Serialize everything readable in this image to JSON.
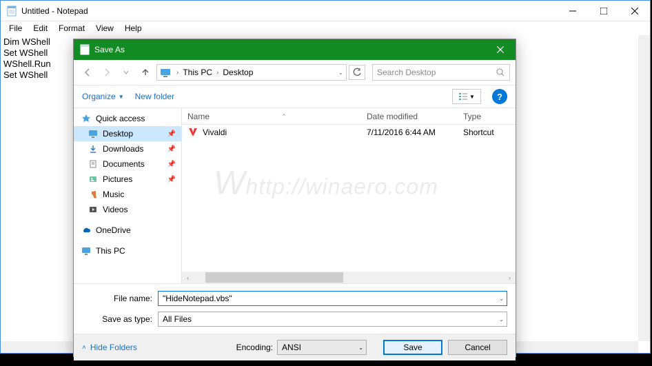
{
  "notepad": {
    "title": "Untitled - Notepad",
    "menu": {
      "file": "File",
      "edit": "Edit",
      "format": "Format",
      "view": "View",
      "help": "Help"
    },
    "content_line1": "Dim WShell",
    "content_line2": "Set WShell",
    "content_line3": "WShell.Run",
    "content_line4": "Set WShell"
  },
  "dialog": {
    "title": "Save As",
    "breadcrumb": {
      "part1": "This PC",
      "part2": "Desktop"
    },
    "search_placeholder": "Search Desktop",
    "toolbar": {
      "organize": "Organize",
      "newfolder": "New folder"
    },
    "nav": {
      "quick_access": "Quick access",
      "desktop": "Desktop",
      "downloads": "Downloads",
      "documents": "Documents",
      "pictures": "Pictures",
      "music": "Music",
      "videos": "Videos",
      "onedrive": "OneDrive",
      "thispc": "This PC"
    },
    "columns": {
      "name": "Name",
      "date": "Date modified",
      "type": "Type"
    },
    "files": [
      {
        "name": "Vivaldi",
        "date": "7/11/2016 6:44 AM",
        "type": "Shortcut"
      }
    ],
    "filename_label": "File name:",
    "filename_value": "\"HideNotepad.vbs\"",
    "saveastype_label": "Save as type:",
    "saveastype_value": "All Files",
    "hide_folders": "Hide Folders",
    "encoding_label": "Encoding:",
    "encoding_value": "ANSI",
    "save": "Save",
    "cancel": "Cancel"
  },
  "watermark": "http://winaero.com"
}
